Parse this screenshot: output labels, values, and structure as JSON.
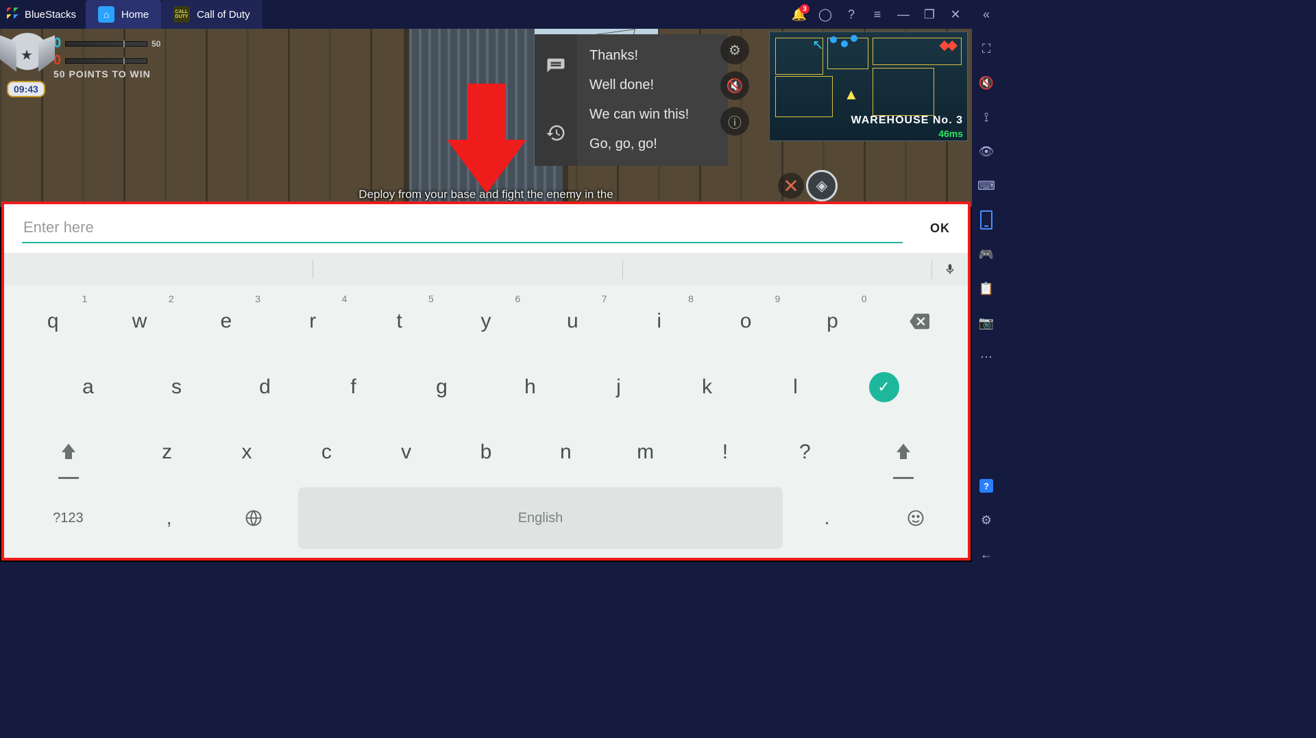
{
  "app": {
    "name": "BlueStacks"
  },
  "tabs": {
    "home": "Home",
    "game": "Call of Duty"
  },
  "notifications": {
    "count": "3"
  },
  "hud": {
    "score_blue": "0",
    "score_red": "0",
    "score_cap": "50",
    "goal_text": "50 POINTS TO WIN",
    "timer": "09:43",
    "deploy_text": "Deploy from your base and fight the enemy in the"
  },
  "quick_chat": {
    "items": [
      "Thanks!",
      "Well done!",
      "We can win this!",
      "Go, go, go!"
    ]
  },
  "minimap": {
    "label": "WAREHOUSE No. 3",
    "ping": "46ms"
  },
  "input": {
    "placeholder": "Enter here",
    "ok": "OK"
  },
  "keyboard": {
    "row1": [
      {
        "k": "q",
        "h": "1"
      },
      {
        "k": "w",
        "h": "2"
      },
      {
        "k": "e",
        "h": "3"
      },
      {
        "k": "r",
        "h": "4"
      },
      {
        "k": "t",
        "h": "5"
      },
      {
        "k": "y",
        "h": "6"
      },
      {
        "k": "u",
        "h": "7"
      },
      {
        "k": "i",
        "h": "8"
      },
      {
        "k": "o",
        "h": "9"
      },
      {
        "k": "p",
        "h": "0"
      }
    ],
    "row2": [
      "a",
      "s",
      "d",
      "f",
      "g",
      "h",
      "j",
      "k",
      "l"
    ],
    "row3": [
      "z",
      "x",
      "c",
      "v",
      "b",
      "n",
      "m",
      "!",
      "?"
    ],
    "sym_label": "?123",
    "comma": ",",
    "period": ".",
    "space_label": "English"
  }
}
